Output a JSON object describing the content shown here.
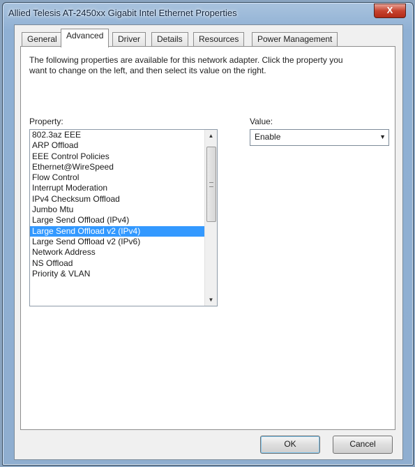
{
  "window": {
    "title": "Allied Telesis AT-2450xx Gigabit Intel Ethernet Properties",
    "close_label": "X"
  },
  "tabs": [
    {
      "label": "General",
      "active": false
    },
    {
      "label": "Advanced",
      "active": true
    },
    {
      "label": "Driver",
      "active": false
    },
    {
      "label": "Details",
      "active": false
    },
    {
      "label": "Resources",
      "active": false
    },
    {
      "label": "Power Management",
      "active": false
    }
  ],
  "advanced": {
    "description": "The following properties are available for this network adapter. Click the property you want to change on the left, and then select its value on the right.",
    "property_label": "Property:",
    "value_label": "Value:",
    "properties": [
      "802.3az EEE",
      "ARP Offload",
      "EEE Control Policies",
      "Ethernet@WireSpeed",
      "Flow Control",
      "Interrupt Moderation",
      "IPv4 Checksum Offload",
      "Jumbo Mtu",
      "Large Send Offload (IPv4)",
      "Large Send Offload v2 (IPv4)",
      "Large Send Offload v2 (IPv6)",
      "Network Address",
      "NS Offload",
      "Priority & VLAN"
    ],
    "selected_index": 9,
    "value": "Enable"
  },
  "buttons": {
    "ok": "OK",
    "cancel": "Cancel"
  }
}
